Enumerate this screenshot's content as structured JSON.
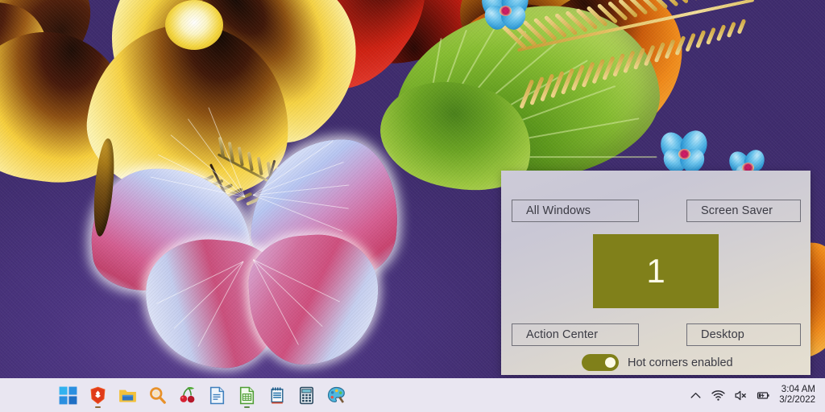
{
  "desktop": {
    "wallpaper_description": "painted pansies, green leaf, golden fern and pink butterfly on purple textured canvas",
    "colors": {
      "wallpaper_purple": "#4a3478",
      "leaf_green": "#86bd31",
      "fern_gold": "#e6c463",
      "butterfly_pink": "#d45d90",
      "taskbar": "#e9e6f1"
    }
  },
  "hot_corners_panel": {
    "colors": {
      "panel_top": "#cdcbd8",
      "panel_bottom": "#e5dfd1",
      "accent_olive": "#80801a",
      "button_border": "#6f6f78",
      "text": "#3b3b44"
    },
    "buttons": [
      {
        "id": "all-windows",
        "label": "All Windows"
      },
      {
        "id": "screen-saver",
        "label": "Screen Saver"
      },
      {
        "id": "action-center",
        "label": "Action Center"
      },
      {
        "id": "desktop",
        "label": "Desktop"
      }
    ],
    "preview": {
      "value": "1"
    },
    "toggle": {
      "label": "Hot corners enabled",
      "state": "on"
    }
  },
  "taskbar": {
    "pinned": [
      {
        "id": "start",
        "name": "windows-start-icon",
        "label": "Start"
      },
      {
        "id": "brave",
        "name": "brave-browser-icon",
        "label": "Brave Browser"
      },
      {
        "id": "file-explorer",
        "name": "folder-icon",
        "label": "File Explorer"
      },
      {
        "id": "search",
        "name": "search-icon",
        "label": "Search"
      },
      {
        "id": "cherry",
        "name": "cherry-icon",
        "label": "Cherrytree"
      },
      {
        "id": "writer",
        "name": "document-icon",
        "label": "LibreOffice Writer"
      },
      {
        "id": "calc",
        "name": "spreadsheet-icon",
        "label": "LibreOffice Calc"
      },
      {
        "id": "notes",
        "name": "notepad-icon",
        "label": "Notepad"
      },
      {
        "id": "calculator",
        "name": "calculator-icon",
        "label": "Calculator"
      },
      {
        "id": "paint",
        "name": "paint-palette-icon",
        "label": "Paint"
      }
    ],
    "tray": [
      {
        "id": "overflow",
        "name": "chevron-up-icon",
        "label": "Show hidden icons"
      },
      {
        "id": "network",
        "name": "wifi-icon",
        "label": "Network"
      },
      {
        "id": "volume",
        "name": "speaker-muted-icon",
        "label": "Volume muted"
      },
      {
        "id": "battery",
        "name": "battery-charging-icon",
        "label": "Battery charging"
      }
    ],
    "clock": {
      "time": "3:04 AM",
      "date": "3/2/2022"
    }
  }
}
